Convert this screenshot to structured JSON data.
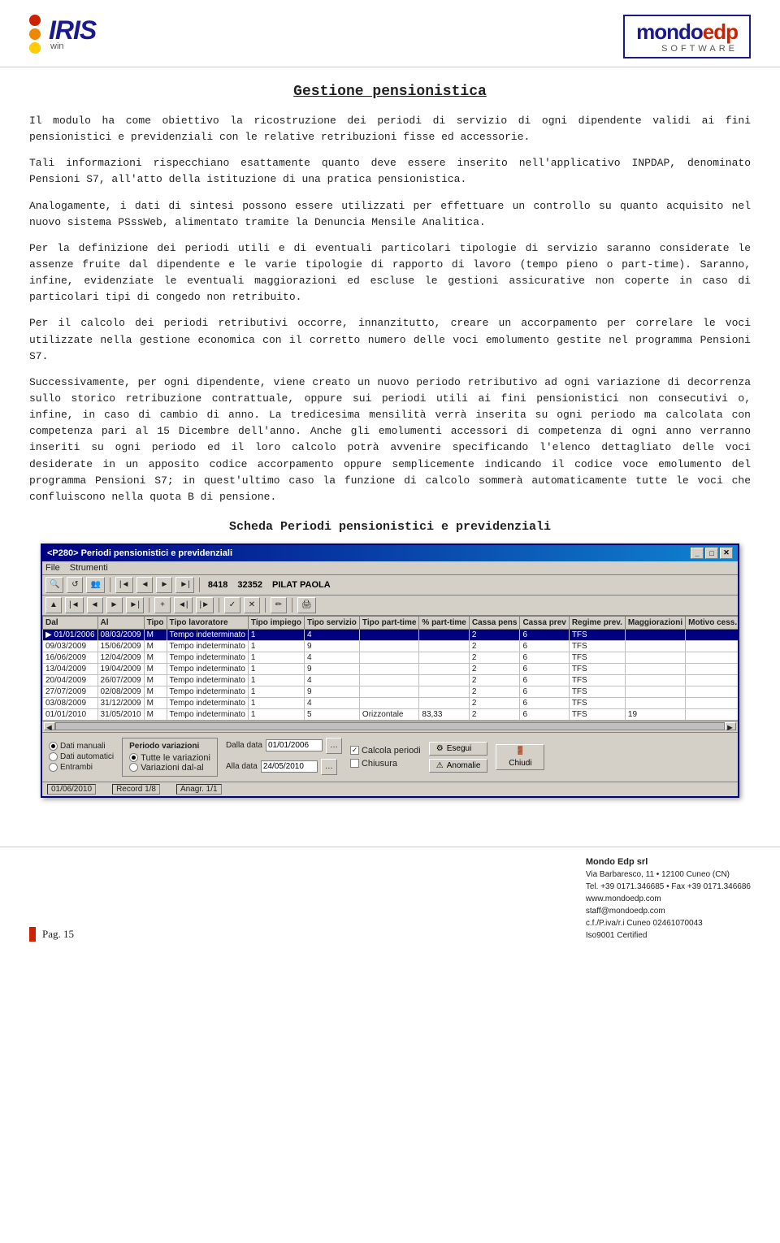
{
  "header": {
    "iris_logo_text": "IRIS",
    "iris_win_text": "win",
    "mondo_logo_main": "mondo",
    "mondo_logo_edp": "edp",
    "software_label": "SOFTWARE"
  },
  "page_title": "Gestione pensionistica",
  "paragraphs": {
    "p1": "Il modulo ha come obiettivo la ricostruzione dei periodi di servizio di ogni dipendente validi ai fini pensionistici e previdenziali con le relative retribuzioni fisse ed accessorie.",
    "p2": "Tali informazioni rispecchiano esattamente quanto deve essere inserito nell'applicativo INPDAP, denominato Pensioni S7, all'atto della istituzione di una pratica pensionistica.",
    "p3": "Analogamente, i dati di sintesi possono essere utilizzati per effettuare un controllo su quanto acquisito nel nuovo sistema PSssWeb, alimentato tramite la Denuncia Mensile Analitica.",
    "p4": "Per la definizione dei periodi utili e di eventuali particolari tipologie di servizio saranno considerate le assenze fruite dal dipendente e le varie tipologie di rapporto di lavoro (tempo pieno o part-time). Saranno, infine, evidenziate le eventuali maggiorazioni ed escluse le gestioni assicurative non coperte in caso di particolari tipi di congedo non retribuito.",
    "p5": "Per il calcolo dei periodi retributivi occorre, innanzitutto, creare un accorpamento per correlare le voci utilizzate nella gestione economica con il corretto numero delle voci emolumento gestite nel programma Pensioni S7.",
    "p6": "Successivamente, per ogni dipendente, viene creato un nuovo periodo retributivo ad ogni variazione di decorrenza sullo storico retribuzione contrattuale, oppure sui periodi utili ai fini pensionistici non consecutivi o, infine, in caso di cambio di anno. La tredicesima mensilità verrà inserita su ogni periodo ma calcolata con competenza pari al 15 Dicembre dell'anno. Anche gli emolumenti accessori di competenza di ogni anno verranno inseriti su ogni periodo ed il loro calcolo potrà avvenire specificando l'elenco dettagliato delle voci desiderate in un apposito codice accorpamento oppure semplicemente indicando il codice voce emolumento del programma Pensioni S7; in quest'ultimo caso la funzione di calcolo sommerà automaticamente tutte le voci che confluiscono nella quota B di pensione."
  },
  "section_title": "Scheda Periodi pensionistici e previdenziali",
  "app_window": {
    "title": "<P280> Periodi pensionistici e previdenziali",
    "menu_items": [
      "File",
      "Strumenti"
    ],
    "toolbar_row1": {
      "nav_code": "8418",
      "record_code": "32352",
      "person_name": "PILAT PAOLA"
    },
    "table": {
      "headers": [
        "Dal",
        "Al",
        "Tipo",
        "Tipo lavoratore",
        "Tipo impiego",
        "Tipo servizio",
        "Tipo part-time",
        "% part-time",
        "Cassa pens",
        "Cassa prev",
        "Regime prev.",
        "Maggiorazioni",
        "Motivo cess."
      ],
      "rows": [
        {
          "dal": "01/01/2006",
          "al": "08/03/2009",
          "tipo": "M",
          "tipo_lav": "Tempo indeterminato",
          "tipo_imp": "1",
          "tipo_serv": "4",
          "tipo_pt": "",
          "perc_pt": "",
          "cassa_p": "2",
          "cassa_pr": "6",
          "regime": "TFS",
          "magg": "",
          "motivo": "",
          "selected": true
        },
        {
          "dal": "09/03/2009",
          "al": "15/06/2009",
          "tipo": "M",
          "tipo_lav": "Tempo indeterminato",
          "tipo_imp": "1",
          "tipo_serv": "9",
          "tipo_pt": "",
          "perc_pt": "",
          "cassa_p": "2",
          "cassa_pr": "6",
          "regime": "TFS",
          "magg": "",
          "motivo": ""
        },
        {
          "dal": "16/06/2009",
          "al": "12/04/2009",
          "tipo": "M",
          "tipo_lav": "Tempo indeterminato",
          "tipo_imp": "1",
          "tipo_serv": "4",
          "tipo_pt": "",
          "perc_pt": "",
          "cassa_p": "2",
          "cassa_pr": "6",
          "regime": "TFS",
          "magg": "",
          "motivo": ""
        },
        {
          "dal": "13/04/2009",
          "al": "19/04/2009",
          "tipo": "M",
          "tipo_lav": "Tempo indeterminato",
          "tipo_imp": "1",
          "tipo_serv": "9",
          "tipo_pt": "",
          "perc_pt": "",
          "cassa_p": "2",
          "cassa_pr": "6",
          "regime": "TFS",
          "magg": "",
          "motivo": ""
        },
        {
          "dal": "20/04/2009",
          "al": "26/07/2009",
          "tipo": "M",
          "tipo_lav": "Tempo indeterminato",
          "tipo_imp": "1",
          "tipo_serv": "4",
          "tipo_pt": "",
          "perc_pt": "",
          "cassa_p": "2",
          "cassa_pr": "6",
          "regime": "TFS",
          "magg": "",
          "motivo": ""
        },
        {
          "dal": "27/07/2009",
          "al": "02/08/2009",
          "tipo": "M",
          "tipo_lav": "Tempo indeterminato",
          "tipo_imp": "1",
          "tipo_serv": "9",
          "tipo_pt": "",
          "perc_pt": "",
          "cassa_p": "2",
          "cassa_pr": "6",
          "regime": "TFS",
          "magg": "",
          "motivo": ""
        },
        {
          "dal": "03/08/2009",
          "al": "31/12/2009",
          "tipo": "M",
          "tipo_lav": "Tempo indeterminato",
          "tipo_imp": "1",
          "tipo_serv": "4",
          "tipo_pt": "",
          "perc_pt": "",
          "cassa_p": "2",
          "cassa_pr": "6",
          "regime": "TFS",
          "magg": "",
          "motivo": ""
        },
        {
          "dal": "01/01/2010",
          "al": "31/05/2010",
          "tipo": "M",
          "tipo_lav": "Tempo indeterminato",
          "tipo_imp": "1",
          "tipo_serv": "5",
          "tipo_pt": "Orizzontale",
          "perc_pt": "83,33",
          "cassa_p": "2",
          "cassa_pr": "6",
          "regime": "TFS",
          "magg": "19",
          "motivo": ""
        }
      ]
    },
    "bottom": {
      "radio_group1": {
        "label": "",
        "options": [
          "Dati manuali",
          "Dati automatici",
          "Entrambi"
        ],
        "selected": "Dati manuali"
      },
      "periodo_variazioni": {
        "title": "Periodo variazioni",
        "options": [
          "Tutte le variazioni",
          "Variazioni dal-al"
        ],
        "selected": "Tutte le variazioni"
      },
      "dalla_data_label": "Dalla data",
      "dalla_data_value": "01/01/2006",
      "alla_data_label": "Alla data",
      "alla_data_value": "24/05/2010",
      "calcola_checkbox": "Calcola periodi",
      "calcola_checked": true,
      "chiusura_checkbox": "Chiusura",
      "chiusura_checked": false,
      "btn_esegui": "Esegui",
      "btn_anomalie": "Anomalie",
      "btn_chiudi": "Chiudi"
    },
    "statusbar": {
      "date": "01/06/2010",
      "record": "Record 1/8",
      "anagr": "Anagr. 1/1"
    }
  },
  "footer": {
    "page_label": "Pag. 15",
    "company_name": "Mondo Edp srl",
    "address": "Via Barbaresco, 11 • 12100 Cuneo (CN)",
    "tel": "Tel. +39 0171.346685 • Fax +39 0171.346686",
    "web": "www.mondoedp.com",
    "email": "staff@mondoedp.com",
    "cf": "c.f./P.iva/r.i Cuneo 02461070043",
    "iso": "Iso9001   Certified"
  }
}
